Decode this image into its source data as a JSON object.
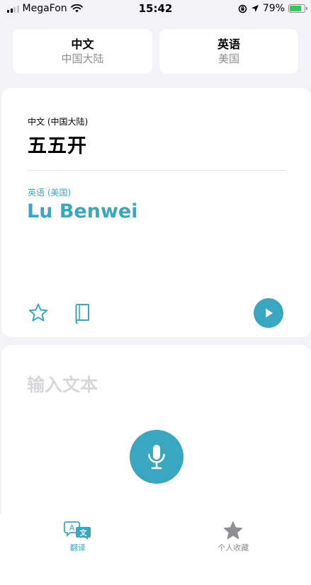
{
  "status_bar": {
    "carrier": "MegaFon",
    "time": "15:42",
    "battery_percent": "79%",
    "battery_level": 0.79,
    "battery_color": "#34c759",
    "icons": [
      "signal-icon",
      "wifi-icon",
      "orientation-lock-icon",
      "location-arrow-icon",
      "battery-icon"
    ]
  },
  "language_tabs": {
    "source": {
      "name": "中文",
      "region": "中国大陆"
    },
    "target": {
      "name": "英语",
      "region": "美国"
    }
  },
  "result": {
    "source_label": "中文 (中国大陆)",
    "source_text": "五五开",
    "target_label": "英语 (美国)",
    "target_text": "Lu Benwei",
    "actions": [
      "star-icon",
      "dictionary-icon",
      "play-icon"
    ]
  },
  "input": {
    "placeholder": "输入文本",
    "value": "",
    "mic_icon": "microphone-icon"
  },
  "tab_bar": {
    "items": [
      {
        "label": "翻译",
        "icon": "translate-icon",
        "active": true
      },
      {
        "label": "个人收藏",
        "icon": "star-filled-icon",
        "active": false
      }
    ]
  },
  "colors": {
    "accent": "#3aa7c0",
    "background": "#f2f2f7",
    "inactive": "#8e8e93"
  }
}
